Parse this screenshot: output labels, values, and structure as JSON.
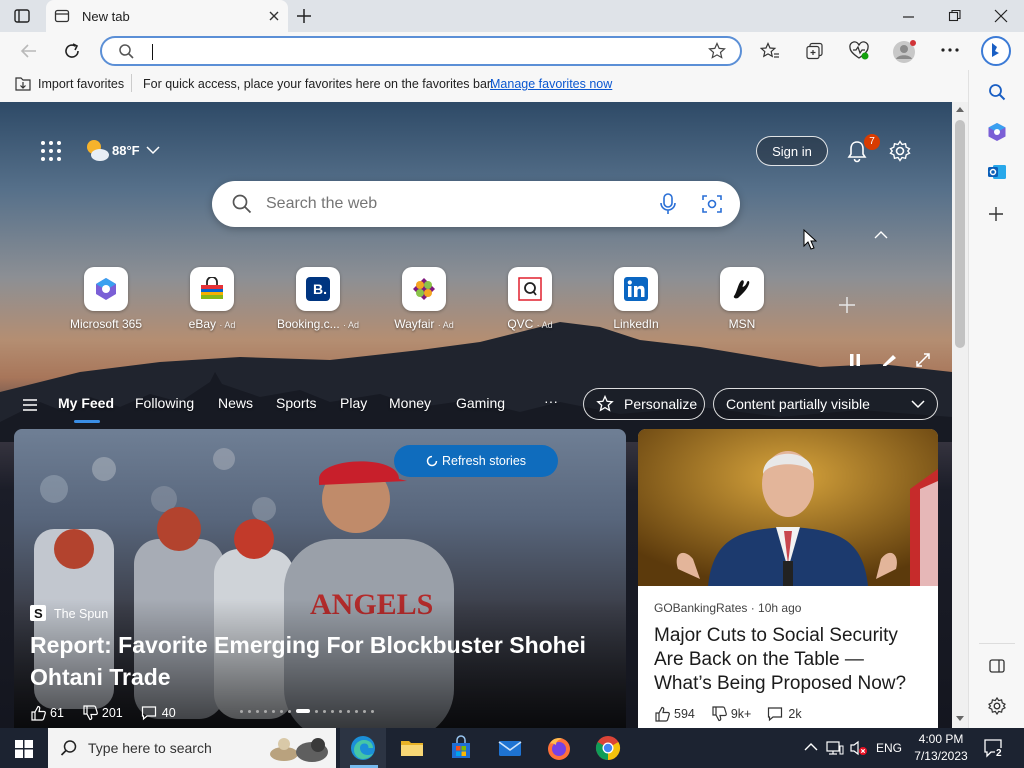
{
  "window": {
    "tab_title": "New tab"
  },
  "address_bar": {
    "value": "",
    "placeholder": ""
  },
  "favorites_bar": {
    "import_label": "Import favorites",
    "message": "For quick access, place your favorites here on the favorites bar.",
    "manage_link": "Manage favorites now"
  },
  "header": {
    "weather": "88°F",
    "sign_in": "Sign in",
    "notification_count": "7"
  },
  "search": {
    "placeholder": "Search the web"
  },
  "quick_links": [
    {
      "label": "Microsoft 365",
      "ad": ""
    },
    {
      "label": "eBay",
      "ad": "· Ad"
    },
    {
      "label": "Booking.c...",
      "ad": "· Ad"
    },
    {
      "label": "Wayfair",
      "ad": "· Ad"
    },
    {
      "label": "QVC",
      "ad": "· Ad"
    },
    {
      "label": "LinkedIn",
      "ad": ""
    },
    {
      "label": "MSN",
      "ad": ""
    }
  ],
  "feed_nav": {
    "items": [
      "My Feed",
      "Following",
      "News",
      "Sports",
      "Play",
      "Money",
      "Gaming"
    ],
    "more": "···",
    "personalize": "Personalize",
    "content_visibility": "Content partially visible"
  },
  "refresh_button": "Refresh stories",
  "hero_story": {
    "source": "The Spun",
    "headline": "Report: Favorite Emerging For Blockbuster Shohei Ohtani Trade",
    "likes": "61",
    "dislikes": "201",
    "comments": "40"
  },
  "side_story": {
    "source": "GOBankingRates · 10h ago",
    "headline": "Major Cuts to Social Security Are Back on the Table — What’s Being Proposed Now?",
    "likes": "594",
    "dislikes": "9k+",
    "comments": "2k"
  },
  "taskbar": {
    "search_placeholder": "Type here to search",
    "language": "ENG",
    "time": "4:00 PM",
    "date": "7/13/2023",
    "notifications": "2"
  },
  "colors": {
    "accent": "#0f6cbd",
    "link": "#0b57d0",
    "badge": "#d83b01"
  }
}
